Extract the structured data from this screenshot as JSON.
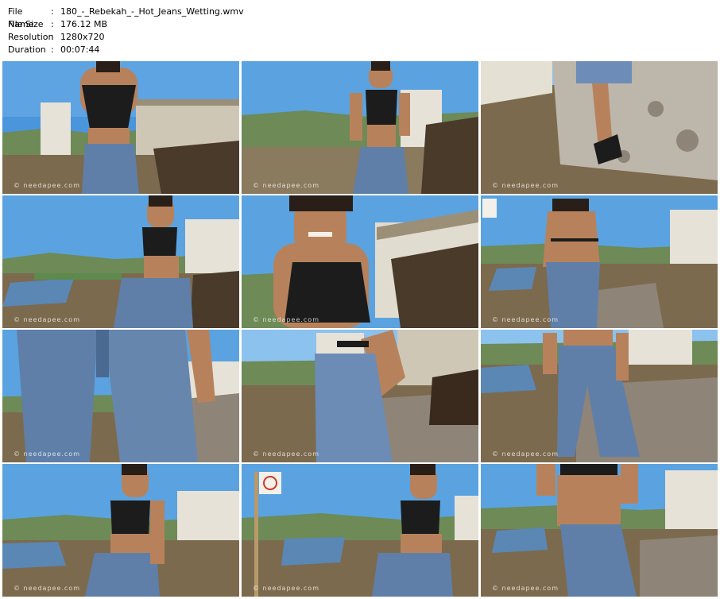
{
  "file_info": {
    "name_label": "File Name",
    "name_value": "180_-_Rebekah_-_Hot_Jeans_Wetting.wmv",
    "size_label": "File Size",
    "size_value": "176.12 MB",
    "resolution_label": "Resolution",
    "resolution_value": "1280x720",
    "duration_label": "Duration",
    "duration_value": "00:07:44",
    "separator": ":"
  },
  "watermark": "© needapee.com",
  "thumbnails": [
    {
      "scene": "woman-black-top-seated-by-white-building"
    },
    {
      "scene": "woman-standing-hills-background"
    },
    {
      "scene": "legs-jeans-flipflops-by-rock"
    },
    {
      "scene": "woman-seated-lagoon-view"
    },
    {
      "scene": "woman-closeup-smiling"
    },
    {
      "scene": "woman-back-view-jeans"
    },
    {
      "scene": "jeans-legs-closeup"
    },
    {
      "scene": "woman-bent-over-rock"
    },
    {
      "scene": "woman-jeans-wet-front"
    },
    {
      "scene": "woman-seated-lagoon-view-2"
    },
    {
      "scene": "woman-seated-by-sign"
    },
    {
      "scene": "woman-midriff-jeans"
    }
  ],
  "colors": {
    "sky": "#4a95dc",
    "sky_light": "#8cc2ee",
    "jeans": "#5f7fa8",
    "skin": "#b7825b",
    "top": "#1c1c1c",
    "rock": "#8e8478",
    "ground": "#7c6a4e",
    "wall": "#e6e2d8",
    "hills": "#6d8a57",
    "water": "#5b87b5"
  }
}
